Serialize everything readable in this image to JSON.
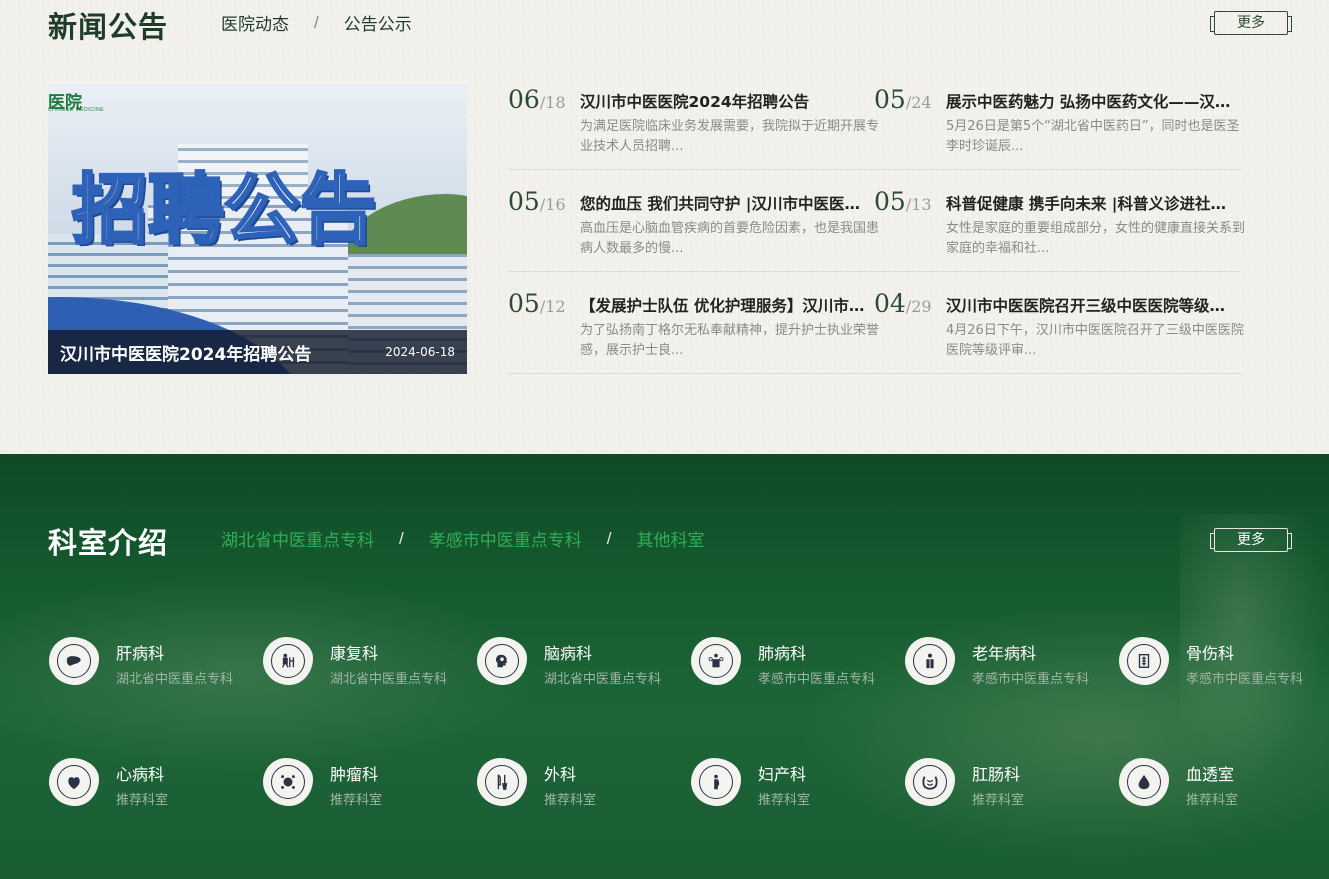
{
  "news": {
    "title": "新闻公告",
    "tabs": [
      "医院动态",
      "公告公示"
    ],
    "separator": "/",
    "more_label": "更多",
    "featured": {
      "logo_text": "医院",
      "logo_sub": "CHINESE MEDICINE",
      "image_headline": "招聘公告",
      "title": "汉川市中医医院2024年招聘公告",
      "date": "2024-06-18"
    },
    "items": [
      {
        "month": "06",
        "day": "/18",
        "title": "汉川市中医医院2024年招聘公告",
        "desc": "为满足医院临床业务发展需要，我院拟于近期开展专业技术人员招聘..."
      },
      {
        "month": "05",
        "day": "/24",
        "title": "展示中医药魅力 弘扬中医药文化——汉川市中医医院开展湖北省中医药日活动",
        "desc": "5月26日是第5个“湖北省中医药日”，同时也是医圣李时珍诞辰..."
      },
      {
        "month": "05",
        "day": "/16",
        "title": "您的血压 我们共同守护 |汉川市中医医院开展世界高血压日义诊活动",
        "desc": "高血压是心脑血管疾病的首要危险因素，也是我国患病人数最多的慢..."
      },
      {
        "month": "05",
        "day": "/13",
        "title": "科普促健康 携手向未来 |科普义诊进社区活动",
        "desc": "女性是家庭的重要组成部分，女性的健康直接关系到家庭的幸福和社..."
      },
      {
        "month": "05",
        "day": "/12",
        "title": "【发展护士队伍 优化护理服务】汉川市中医医院庆祝国际护士节",
        "desc": "为了弘扬南丁格尔无私奉献精神，提升护士执业荣誉感，展示护士良..."
      },
      {
        "month": "04",
        "day": "/29",
        "title": "汉川市中医医院召开三级中医医院等级评审动员大会",
        "desc": "4月26日下午，汉川市中医医院召开了三级中医医院医院等级评审..."
      }
    ]
  },
  "departments": {
    "title": "科室介绍",
    "tabs": [
      "湖北省中医重点专科",
      "孝感市中医重点专科",
      "其他科室"
    ],
    "separator": "/",
    "more_label": "更多",
    "items": [
      {
        "name": "肝病科",
        "tag": "湖北省中医重点专科",
        "icon": "liver-icon"
      },
      {
        "name": "康复科",
        "tag": "湖北省中医重点专科",
        "icon": "rehab-icon"
      },
      {
        "name": "脑病科",
        "tag": "湖北省中医重点专科",
        "icon": "brain-icon"
      },
      {
        "name": "肺病科",
        "tag": "孝感市中医重点专科",
        "icon": "lung-icon"
      },
      {
        "name": "老年病科",
        "tag": "孝感市中医重点专科",
        "icon": "elderly-icon"
      },
      {
        "name": "骨伤科",
        "tag": "孝感市中医重点专科",
        "icon": "bone-icon"
      },
      {
        "name": "心病科",
        "tag": "推荐科室",
        "icon": "heart-icon"
      },
      {
        "name": "肿瘤科",
        "tag": "推荐科室",
        "icon": "tumor-icon"
      },
      {
        "name": "外科",
        "tag": "推荐科室",
        "icon": "surgery-icon"
      },
      {
        "name": "妇产科",
        "tag": "推荐科室",
        "icon": "obstetrics-icon"
      },
      {
        "name": "肛肠科",
        "tag": "推荐科室",
        "icon": "intestine-icon"
      },
      {
        "name": "血透室",
        "tag": "推荐科室",
        "icon": "blood-drop-icon"
      }
    ]
  }
}
